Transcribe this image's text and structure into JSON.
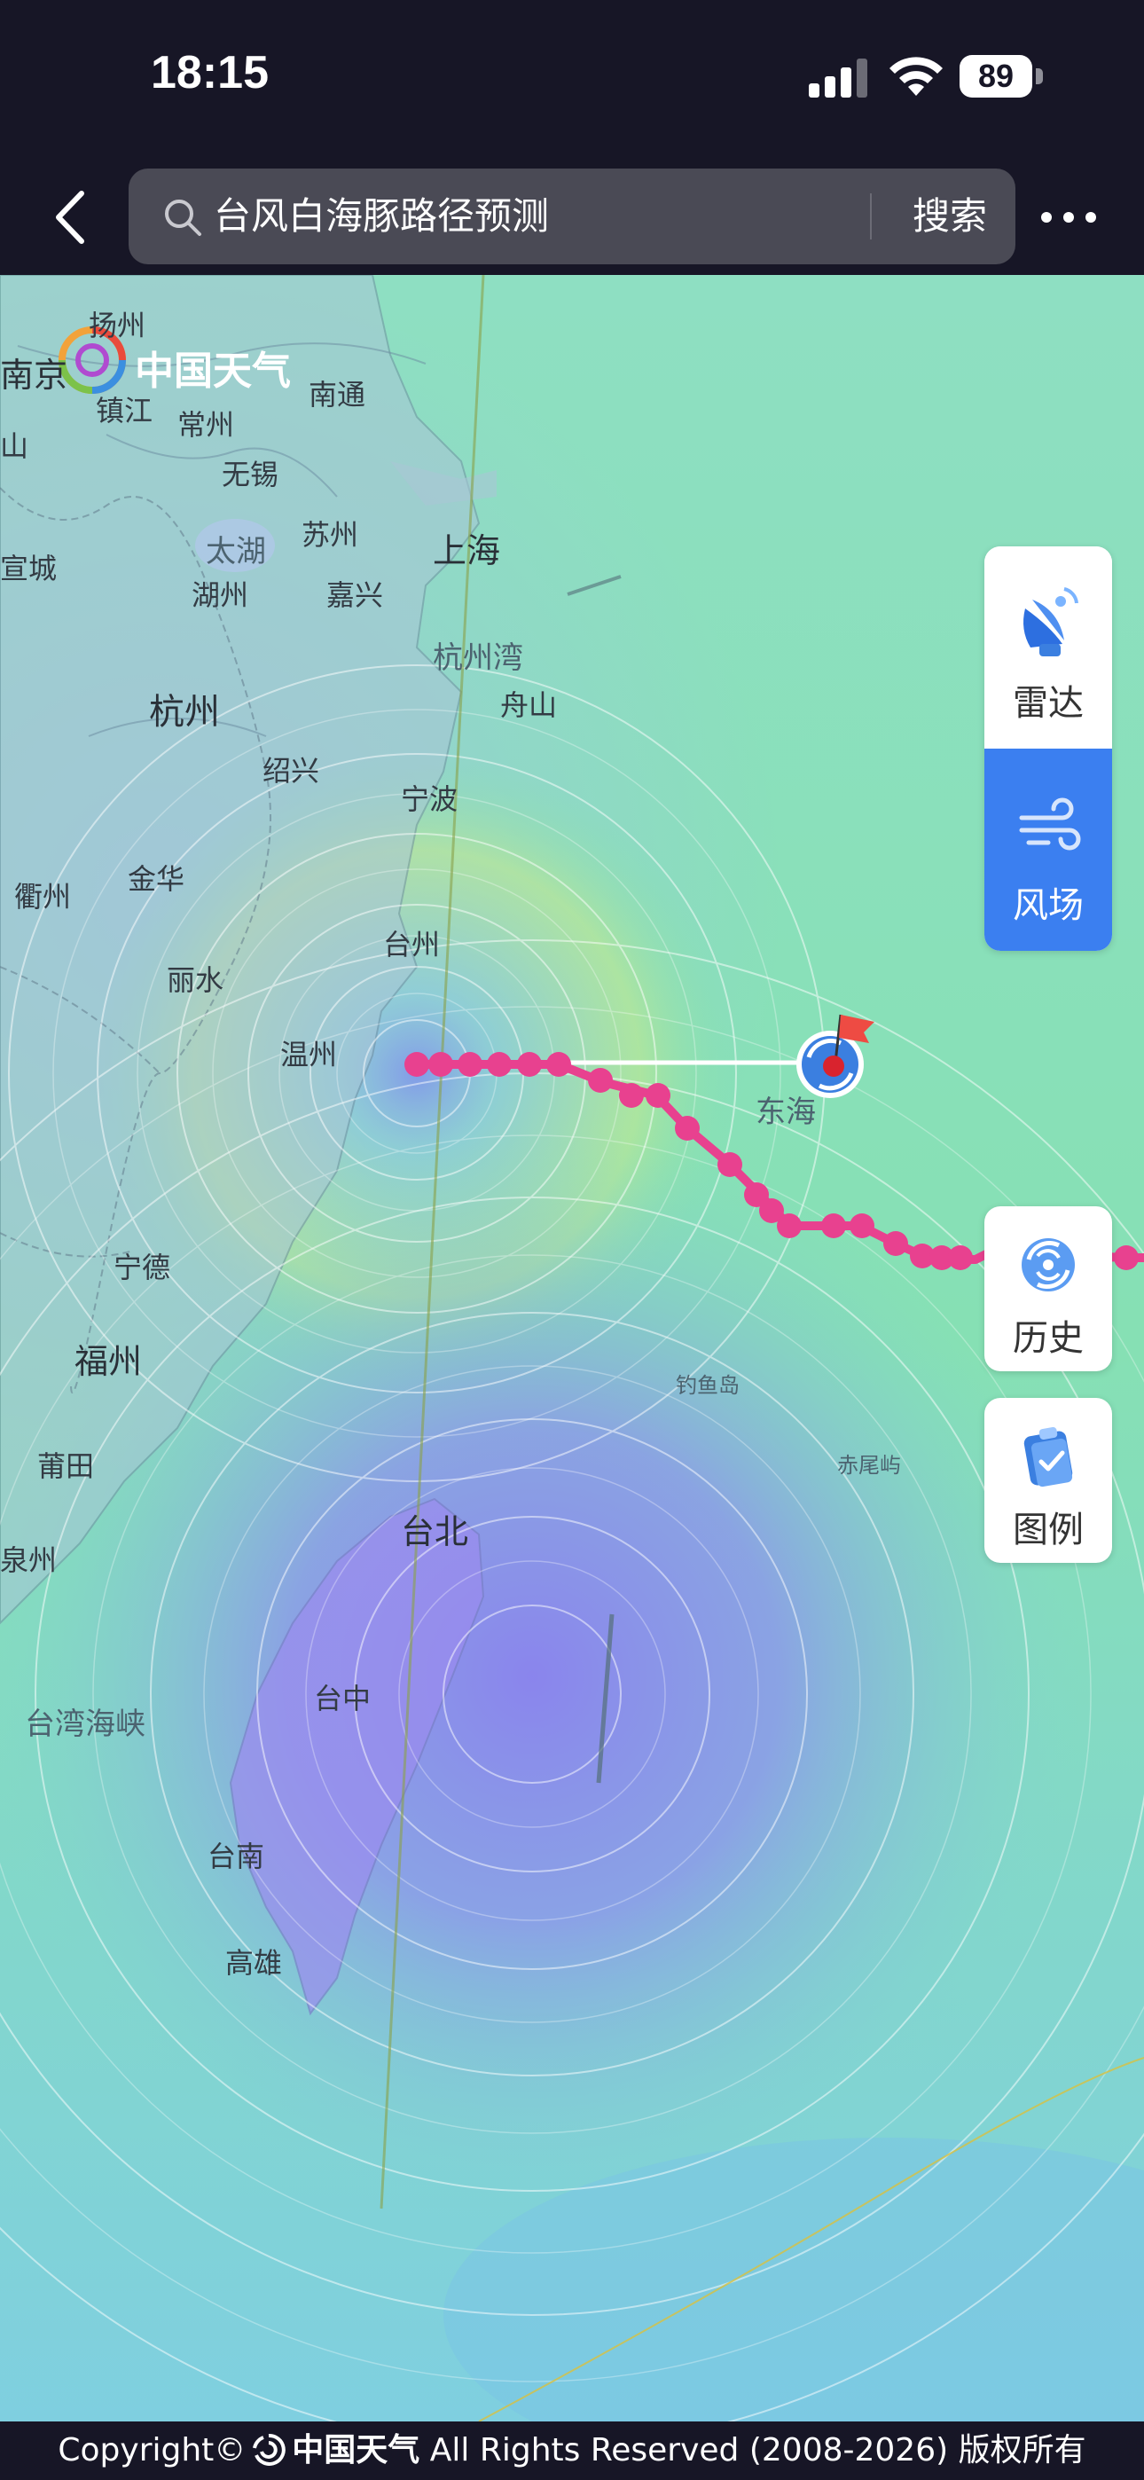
{
  "status_bar": {
    "time": "18:15",
    "battery": "89"
  },
  "search": {
    "query": "台风白海豚路径预测",
    "button": "搜索"
  },
  "map": {
    "logo_text": "中国天气",
    "cities": {
      "yangzhou": "扬州",
      "nanjing": "南京",
      "zhenjiang": "镇江",
      "changzhou": "常州",
      "nantong": "南通",
      "wuxi": "无锡",
      "suzhou": "苏州",
      "shanghai": "上海",
      "taihu": "太湖",
      "xuancheng": "宣城",
      "huzhou": "湖州",
      "jiaxing": "嘉兴",
      "hangzhouwan": "杭州湾",
      "hangzhou": "杭州",
      "zhoushan": "舟山",
      "shaoxing": "绍兴",
      "ningbo": "宁波",
      "quzhou": "衢州",
      "jinhua": "金华",
      "taizhou": "台州",
      "lishui": "丽水",
      "wenzhou": "温州",
      "ningde": "宁德",
      "fuzhou": "福州",
      "putian": "莆田",
      "quanzhou": "泉州",
      "taibei": "台北",
      "taiwan_strait": "台湾海峡",
      "taizhong": "台中",
      "tainan": "台南",
      "gaoxiong": "高雄",
      "diaoyudao": "钓鱼岛",
      "chiweiyu": "赤尾屿",
      "donghai": "东海",
      "mountain_mark": "山"
    },
    "typhoon_track_color": "#e8418f",
    "wind_low_color": "#8a80ef",
    "wind_mid_color": "#7ee3a8",
    "wind_high_color": "#b5ea8a"
  },
  "layers": {
    "radar": "雷达",
    "wind": "风场",
    "active": "wind"
  },
  "buttons": {
    "history": "历史",
    "legend": "图例"
  },
  "footer": {
    "copyright_prefix": "Copyright©",
    "brand": "中国天气",
    "rights": "All Rights Reserved (2008-2026) 版权所有"
  }
}
